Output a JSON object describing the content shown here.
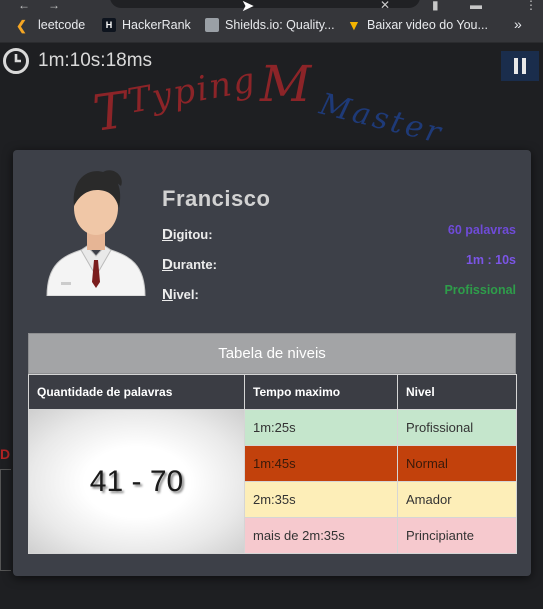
{
  "bookmarks": [
    {
      "label": "leetcode",
      "icon": "leetcode-icon",
      "color": "#f5a623"
    },
    {
      "label": "HackerRank",
      "icon": "hackerrank-icon",
      "color": "#1ba94c"
    },
    {
      "label": "Shields.io: Quality...",
      "icon": "shields-icon",
      "color": "#9aa0a6"
    },
    {
      "label": "Baixar video do You...",
      "icon": "download-icon",
      "color": "#f4b400"
    }
  ],
  "timer": {
    "text": "1m:10s:18ms"
  },
  "logo": {
    "text1": "Typing",
    "text2": "Master"
  },
  "side_letter": "D",
  "result": {
    "name": "Francisco",
    "typed_label_first": "D",
    "typed_label_rest": "igitou:",
    "typed_value": "60 palavras",
    "typed_color": "#6f4bd8",
    "duration_label_first": "D",
    "duration_label_rest": "urante:",
    "duration_value": "1m : 10s",
    "duration_color": "#7b55e6",
    "level_label_first": "N",
    "level_label_rest": "ivel:",
    "level_value": "Profissional",
    "level_color": "#2e9d4a"
  },
  "levels_table": {
    "caption": "Tabela de niveis",
    "headers": [
      "Quantidade de palavras",
      "Tempo maximo",
      "Nivel"
    ],
    "range": "41 - 70",
    "rows": [
      {
        "time": "1m:25s",
        "level": "Profissional",
        "color": "#c5e6cc"
      },
      {
        "time": "1m:45s",
        "level": "Normal",
        "color": "#c2410c"
      },
      {
        "time": "2m:35s",
        "level": "Amador",
        "color": "#fdeeb8"
      },
      {
        "time": "mais de 2m:35s",
        "level": "Principiante",
        "color": "#f6c9ce"
      }
    ]
  }
}
